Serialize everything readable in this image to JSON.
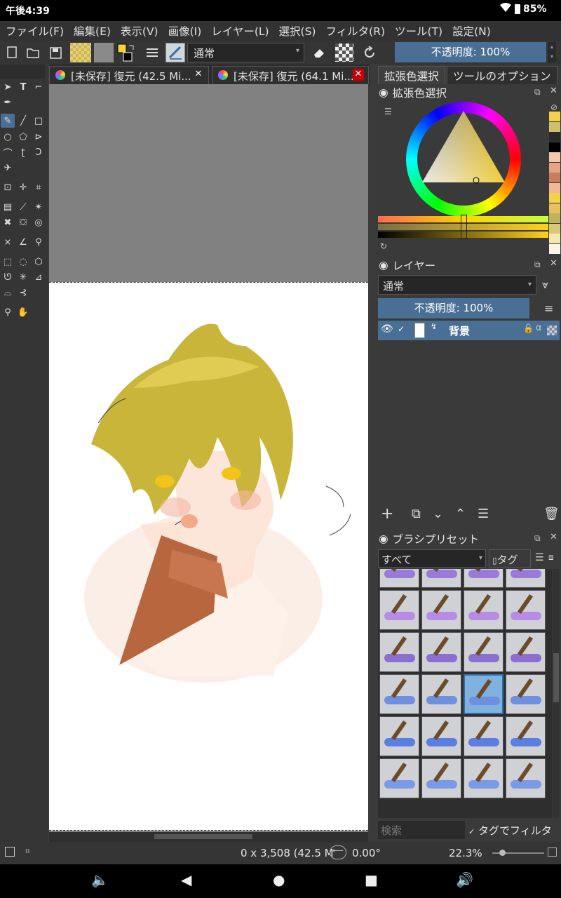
{
  "status": {
    "time": "午後4:39",
    "battery": "85%"
  },
  "menu": [
    "ファイル(F)",
    "編集(E)",
    "表示(V)",
    "画像(I)",
    "レイヤー(L)",
    "選択(S)",
    "フィルタ(R)",
    "ツール(T)",
    "設定(N)"
  ],
  "toolbar": {
    "blend_mode": "通常",
    "opacity": "不透明度: 100%"
  },
  "tabs": [
    {
      "label": "[未保存] 復元 (42.5 Mi..."
    },
    {
      "label": "[未保存] 復元 (64.1 Mi..."
    }
  ],
  "dock_tabs": [
    "拡張色選択",
    "ツールのオプション"
  ],
  "color_panel": {
    "title": "拡張色選択",
    "swatches": [
      "#f2d24a",
      "#cfc06a",
      "#2a2a2a",
      "#000000",
      "#f3c7a9",
      "#e7a383",
      "#c97d5c",
      "#f1b896",
      "#f2d24a",
      "#e7c15c",
      "#bfb25a",
      "#d9c77a",
      "#f6e6b0",
      "#fbf3e6"
    ]
  },
  "layers_panel": {
    "title": "レイヤー",
    "blend_mode": "通常",
    "opacity": "不透明度: 100%",
    "layer_name": "背景"
  },
  "brush_panel": {
    "title": "ブラシプリセット",
    "filter": "すべて",
    "tag_label": "タグ",
    "search_placeholder": "検索",
    "tag_filter": "タグでフィルタ"
  },
  "bottom": {
    "dimensions": "0 x 3,508 (42.5 M",
    "rotation": "0.00°",
    "zoom": "22.3%"
  },
  "colors": {
    "accent": "#4a6f94",
    "fg_color": "#f5d63a",
    "selected_brush": "#7fb3dd"
  }
}
